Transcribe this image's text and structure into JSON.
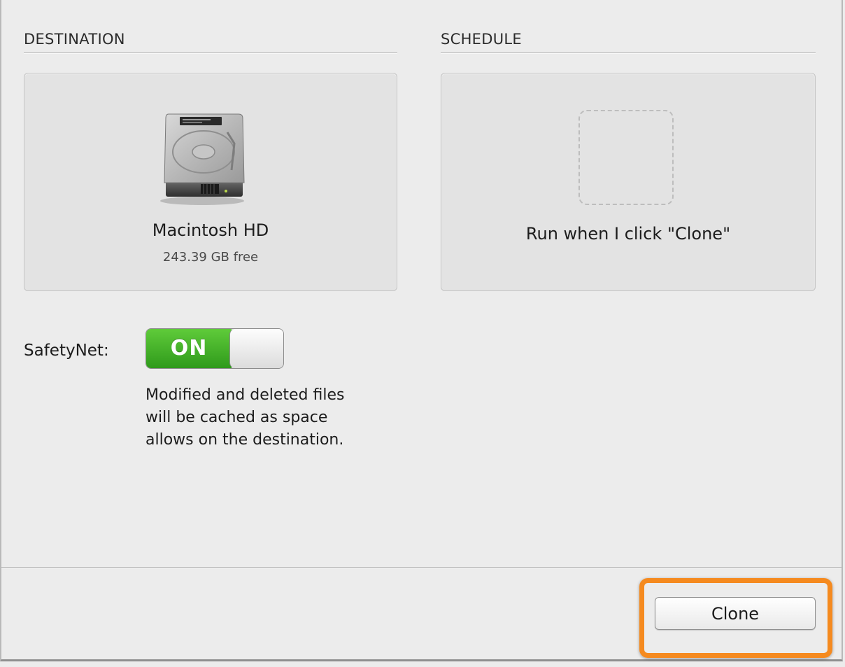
{
  "destination": {
    "section_title": "DESTINATION",
    "icon": "hard-drive-icon",
    "drive_name": "Macintosh HD",
    "free_space": "243.39 GB free"
  },
  "schedule": {
    "section_title": "SCHEDULE",
    "description": "Run when I click \"Clone\""
  },
  "safetynet": {
    "label": "SafetyNet:",
    "toggle_state": "ON",
    "description_lines": [
      "Modified and deleted files",
      "will be cached as space",
      "allows on the destination."
    ]
  },
  "footer": {
    "clone_button": "Clone",
    "highlight_color": "#f58a1f"
  },
  "colors": {
    "toggle_on": "#3fae26",
    "background": "#ececec"
  }
}
